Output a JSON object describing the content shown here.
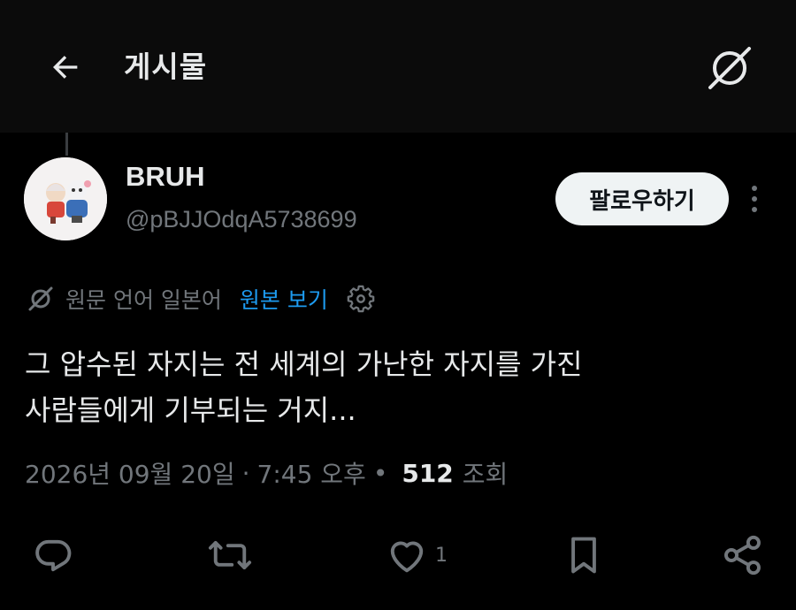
{
  "header": {
    "title": "게시물",
    "back_icon": "arrow-left-icon",
    "grok_icon": "grok-icon"
  },
  "author": {
    "display_name": "BRUH",
    "handle": "@pBJJOdqA5738699"
  },
  "follow_label": "팔로우하기",
  "translation": {
    "note": "원문 언어 일본어",
    "show_original": "원본 보기"
  },
  "tweet": {
    "line1": "그 압수된 자지는 전 세계의 가난한 자지를 가진",
    "line2": "사람들에게 기부되는 거지..."
  },
  "meta": {
    "date": "2026년 09월 20일",
    "time": "7:45 오후",
    "views": "512",
    "views_label": "조회"
  },
  "actions": {
    "like_count": "1"
  },
  "colors": {
    "background": "#000000",
    "text": "#e7e9ea",
    "muted": "#71767b",
    "accent": "#1d9bf0",
    "follow_bg": "#eff3f4"
  }
}
